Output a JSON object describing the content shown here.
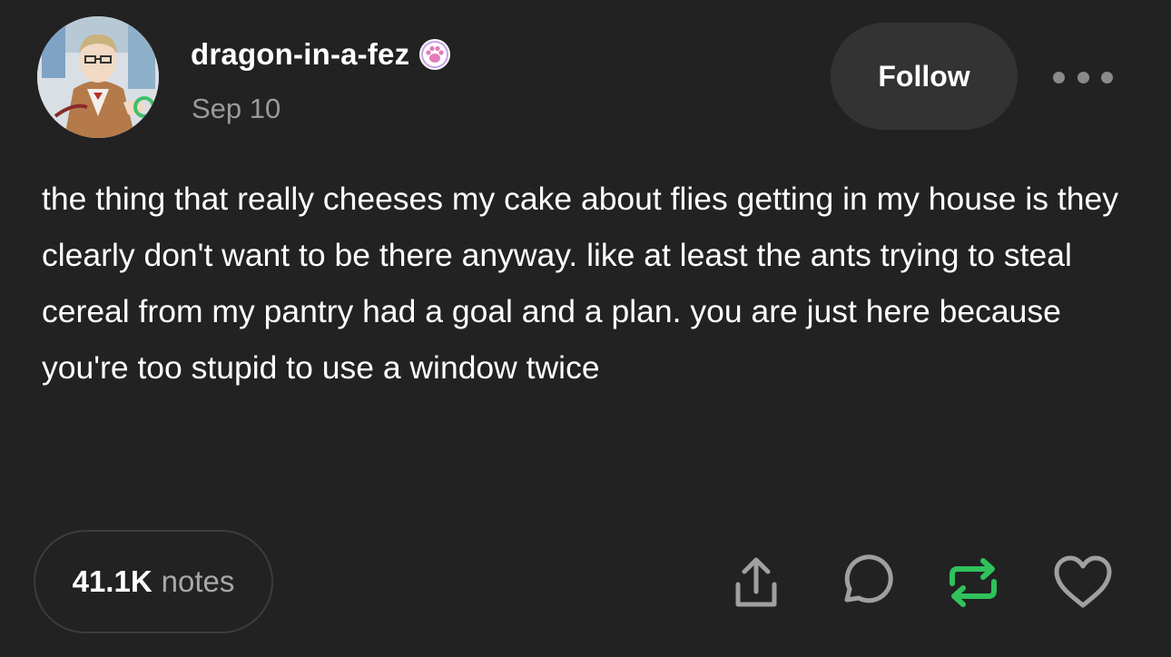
{
  "post": {
    "author": {
      "username": "dragon-in-a-fez",
      "avatar": "avatar-image",
      "badge_icon": "paw-badge-icon"
    },
    "date": "Sep 10",
    "follow_label": "Follow",
    "more_icon": "more-options-icon",
    "body": "the thing that really cheeses my cake about flies getting in my house is they clearly don't want to be there anyway. like at least the ants trying to steal cereal from my pantry had a goal and a plan. you are just here because you're too stupid to use a window twice",
    "notes": {
      "count": "41.1K",
      "label": "notes"
    },
    "actions": {
      "share_icon": "share-icon",
      "reply_icon": "reply-icon",
      "reblog_icon": "reblog-icon",
      "like_icon": "heart-icon"
    }
  },
  "colors": {
    "background": "#222222",
    "follow_button_bg": "#333333",
    "muted_text": "#9a9a9a",
    "reblog_green": "#2fc25b",
    "icon_gray": "#a0a0a0"
  }
}
